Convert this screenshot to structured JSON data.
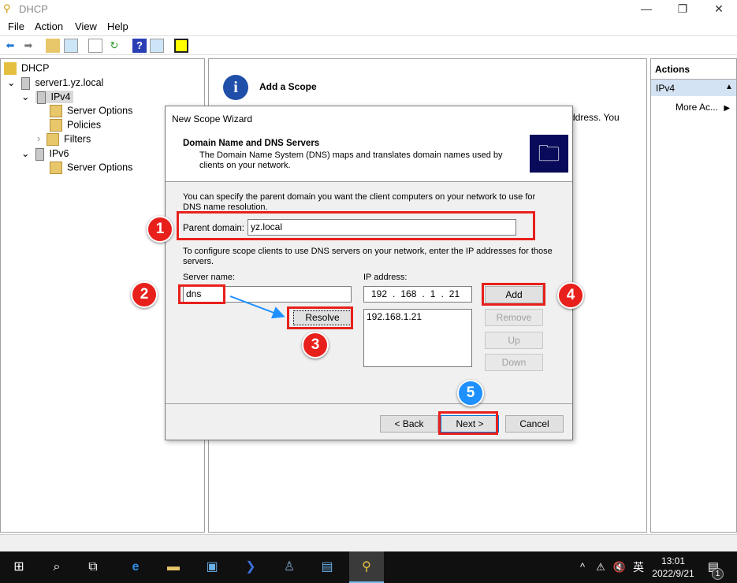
{
  "window": {
    "title": "DHCP",
    "minimize": "—",
    "maximize": "❐",
    "close": "✕"
  },
  "menu": [
    "File",
    "Action",
    "View",
    "Help"
  ],
  "tree": {
    "root": "DHCP",
    "server": "server1.yz.local",
    "ipv4": "IPv4",
    "ipv4_children": [
      "Server Options",
      "Policies",
      "Filters"
    ],
    "ipv6": "IPv6",
    "ipv6_children": [
      "Server Options"
    ]
  },
  "middle": {
    "heading": "Add a Scope",
    "partial_text": "ddress. You"
  },
  "actions": {
    "header": "Actions",
    "section": "IPv4",
    "more": "More Ac..."
  },
  "wizard": {
    "title": "New Scope Wizard",
    "heading": "Domain Name and DNS Servers",
    "subtitle": "The Domain Name System (DNS) maps and translates domain names used by clients on your network.",
    "intro": "You can specify the parent domain you want the client computers on your network to use for DNS name resolution.",
    "parent_domain_label": "Parent domain:",
    "parent_domain_value": "yz.local",
    "dns_intro": "To configure scope clients to use DNS servers on your network, enter the IP addresses for those servers.",
    "server_name_label": "Server name:",
    "server_name_value": "dns",
    "ip_label": "IP address:",
    "ip_octets": [
      "192",
      "168",
      "1",
      "21"
    ],
    "ip_list": [
      "192.168.1.21"
    ],
    "resolve": "Resolve",
    "add": "Add",
    "remove": "Remove",
    "up": "Up",
    "down": "Down",
    "back": "< Back",
    "next": "Next >",
    "cancel": "Cancel"
  },
  "badges": [
    "1",
    "2",
    "3",
    "4",
    "5"
  ],
  "colors": {
    "annotation_red": "#e8201c",
    "annotation_blue": "#1e90ff"
  },
  "taskbar": {
    "time": "13:01",
    "date": "2022/9/21",
    "ime": "英",
    "notifications": "1"
  }
}
